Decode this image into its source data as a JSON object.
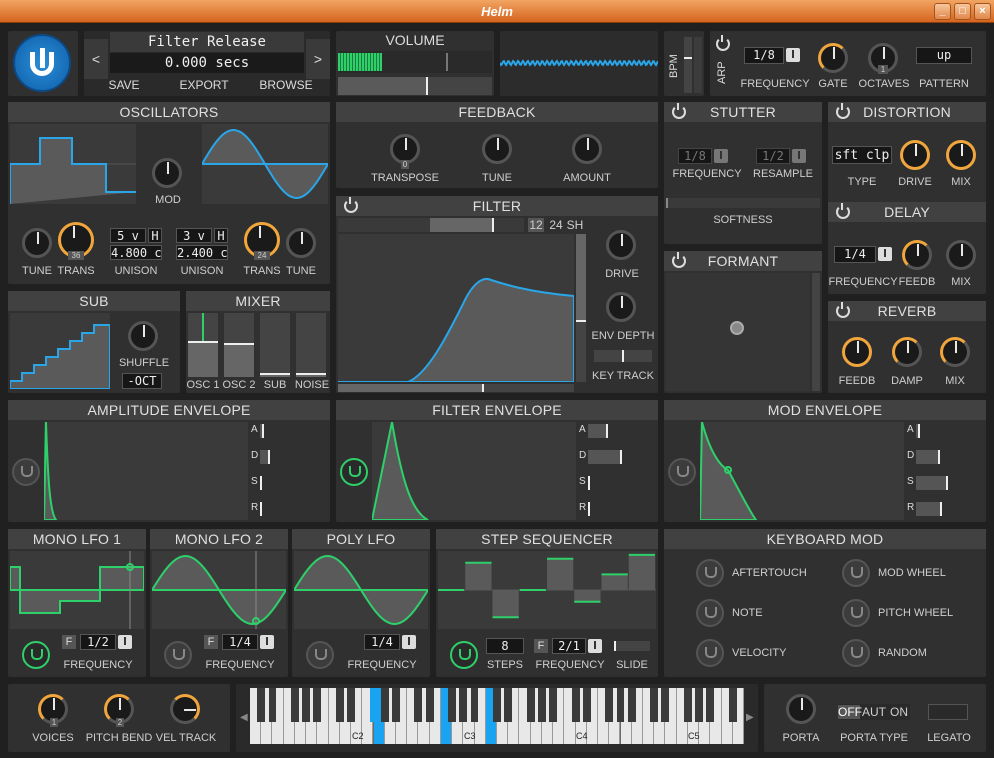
{
  "window": {
    "title": "Helm",
    "min": "_",
    "max": "□",
    "close": "×"
  },
  "patch": {
    "prev": "<",
    "next": ">",
    "name": "Filter Release",
    "value": "0.000 secs",
    "save": "SAVE",
    "export": "EXPORT",
    "browse": "BROWSE"
  },
  "volume": {
    "title": "VOLUME"
  },
  "bpm": {
    "label": "BPM"
  },
  "arp": {
    "label": "ARP",
    "freq_value": "1/8",
    "freq": "FREQUENCY",
    "gate": "GATE",
    "octaves": "OCTAVES",
    "octaves_value": "1",
    "pattern": "PATTERN",
    "pattern_value": "up"
  },
  "oscillators": {
    "title": "OSCILLATORS",
    "mod": "MOD",
    "tune1": "TUNE",
    "trans1": "TRANS",
    "trans1_value": "36",
    "unison1": "UNISON",
    "voices1": "5 v",
    "h1": "H",
    "detune1": "4.800 c",
    "voices2": "3 v",
    "h2": "H",
    "detune2": "2.400 c",
    "unison2": "UNISON",
    "trans2": "TRANS",
    "trans2_value": "24",
    "tune2": "TUNE"
  },
  "feedback": {
    "title": "FEEDBACK",
    "transpose": "TRANSPOSE",
    "transpose_value": "0",
    "tune": "TUNE",
    "amount": "AMOUNT"
  },
  "filter": {
    "title": "FILTER",
    "slope12": "12",
    "slope24": "24",
    "sh": "SH",
    "drive": "DRIVE",
    "env_depth": "ENV DEPTH",
    "key_track": "KEY TRACK"
  },
  "stutter": {
    "title": "STUTTER",
    "freq_value": "1/8",
    "resample_value": "1/2",
    "frequency": "FREQUENCY",
    "resample": "RESAMPLE",
    "softness": "SOFTNESS"
  },
  "distortion": {
    "title": "DISTORTION",
    "type_value": "sft clp",
    "type": "TYPE",
    "drive": "DRIVE",
    "mix": "MIX"
  },
  "delay": {
    "title": "DELAY",
    "freq_value": "1/4",
    "frequency": "FREQUENCY",
    "feedb": "FEEDB",
    "mix": "MIX"
  },
  "formant": {
    "title": "FORMANT"
  },
  "reverb": {
    "title": "REVERB",
    "feedb": "FEEDB",
    "damp": "DAMP",
    "mix": "MIX"
  },
  "sub": {
    "title": "SUB",
    "shuffle": "SHUFFLE",
    "oct": "-OCT"
  },
  "mixer": {
    "title": "MIXER",
    "osc1": "OSC 1",
    "osc2": "OSC 2",
    "sub": "SUB",
    "noise": "NOISE"
  },
  "envelopes": {
    "amp": "AMPLITUDE ENVELOPE",
    "filter": "FILTER ENVELOPE",
    "mod": "MOD ENVELOPE",
    "a": "A",
    "d": "D",
    "s": "S",
    "r": "R"
  },
  "lfo1": {
    "title": "MONO LFO 1",
    "f": "F",
    "value": "1/2",
    "frequency": "FREQUENCY"
  },
  "lfo2": {
    "title": "MONO LFO 2",
    "f": "F",
    "value": "1/4",
    "frequency": "FREQUENCY"
  },
  "polylfo": {
    "title": "POLY LFO",
    "value": "1/4",
    "frequency": "FREQUENCY"
  },
  "stepseq": {
    "title": "STEP SEQUENCER",
    "steps_value": "8",
    "steps": "STEPS",
    "f": "F",
    "freq_value": "2/1",
    "frequency": "FREQUENCY",
    "slide": "SLIDE"
  },
  "keymod": {
    "title": "KEYBOARD MOD",
    "aftertouch": "AFTERTOUCH",
    "modwheel": "MOD WHEEL",
    "note": "NOTE",
    "pitchwheel": "PITCH WHEEL",
    "velocity": "VELOCITY",
    "random": "RANDOM"
  },
  "bottom": {
    "voices": "VOICES",
    "voices_value": "1",
    "pitchbend": "PITCH BEND",
    "pitchbend_value": "2",
    "veltrack": "VEL TRACK",
    "c2": "C2",
    "c3": "C3",
    "c4": "C4",
    "c5": "C5",
    "porta": "PORTA",
    "porta_type": "PORTA TYPE",
    "off": "OFF",
    "aut": "AUT",
    "on": "ON",
    "legato": "LEGATO"
  },
  "colors": {
    "accent": "#2ed06a",
    "osc": "#2aa6e8",
    "knob_orange": "#f0a63c",
    "key_pressed": "#1aa3f0"
  }
}
